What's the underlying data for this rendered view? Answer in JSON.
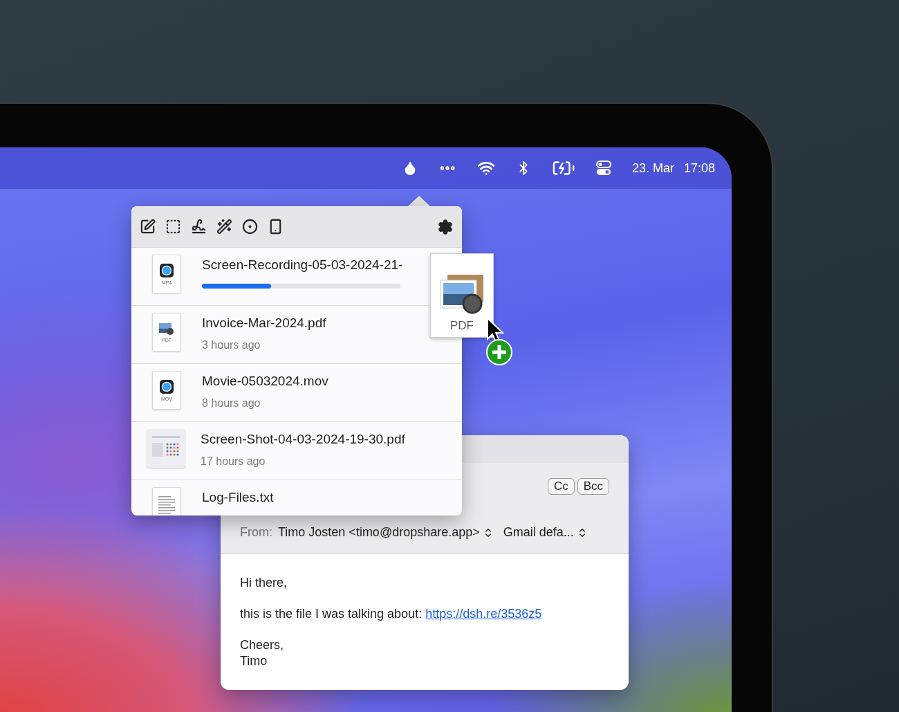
{
  "menu_bar": {
    "date": "23. Mar",
    "time": "17:08"
  },
  "files": [
    {
      "name": "Screen-Recording-05-03-2024-21-",
      "kind": "video",
      "badge": "MP4",
      "level": 0.35
    },
    {
      "name": "Invoice-Mar-2024.pdf",
      "kind": "pdf",
      "badge": "PDF",
      "time": "3 hours ago"
    },
    {
      "name": "Movie-05032024.mov",
      "kind": "video",
      "badge": "MOV",
      "time": "8 hours ago"
    },
    {
      "name": "Screen-Shot-04-03-2024-19-30.pdf",
      "kind": "screenshot",
      "time": "17 hours ago"
    },
    {
      "name": "Log-Files.txt",
      "kind": "text"
    }
  ],
  "dragged_file": {
    "label": "PDF"
  },
  "mail": {
    "cc": "Cc",
    "bcc": "Bcc",
    "from_label": "From:",
    "from": "Timo Josten <timo@dropshare.app>",
    "account": "Gmail defa...",
    "body": [
      {
        "lines": [
          "Hi there,"
        ]
      },
      {
        "lines": [
          "this is the file I was talking about:"
        ],
        "link": "https://dsh.re/3536z5"
      },
      {
        "lines": [
          "Cheers,",
          "Timo"
        ]
      }
    ]
  }
}
